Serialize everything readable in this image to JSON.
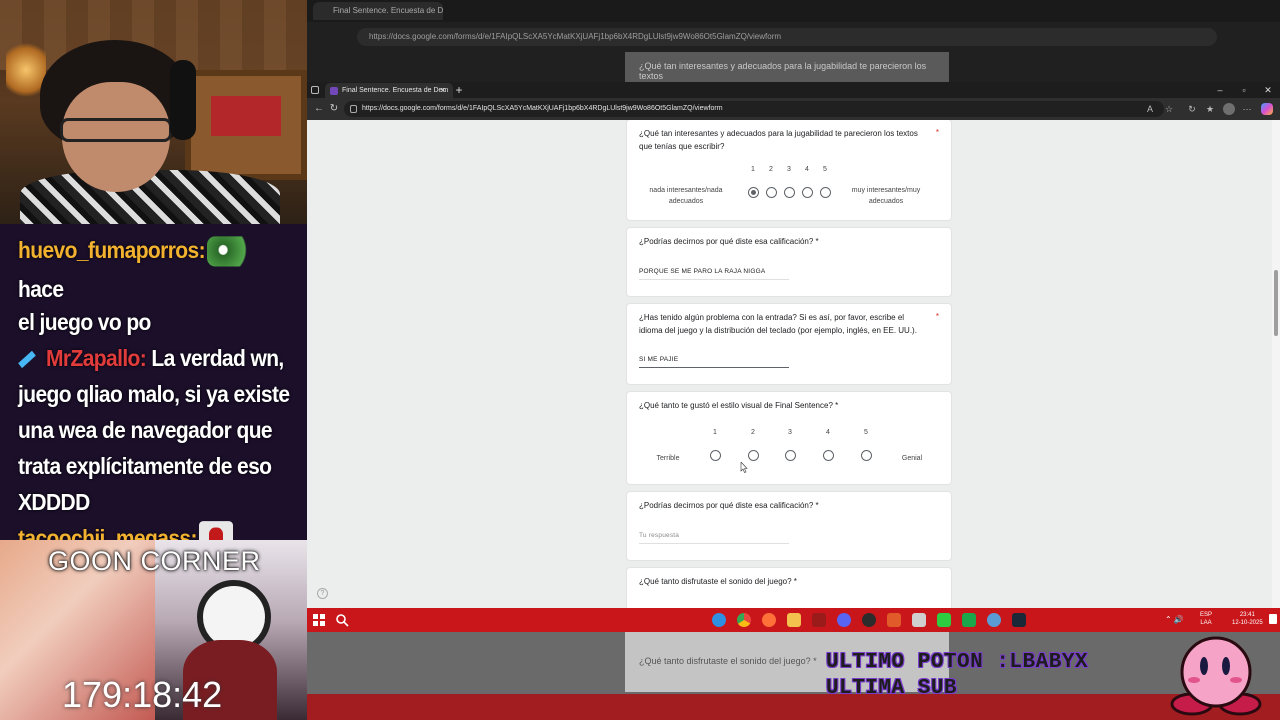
{
  "stream": {
    "chat": [
      {
        "user": "huevo_fumaporros:",
        "message_a": "hace",
        "message_b": "el juego vo po"
      },
      {
        "user": "MrZapallo:",
        "message_a": "La verdad wn,",
        "message_b": "juego qliao malo, si ya existe",
        "message_c": "una wea de navegador que",
        "message_d": "trata explícitamente de eso",
        "message_e": "XDDDD"
      },
      {
        "user": "tacoochii_megass:",
        "emote": "amogus-emote"
      }
    ],
    "panel_title": "GOON CORNER",
    "timer": "179:18:42",
    "banner": "ULTIMO POTON :LBABYX\nULTIMA SUB"
  },
  "bg_browser": {
    "tab_title": "Final Sentence. Encuesta de Dem...",
    "url": "https://docs.google.com/forms/d/e/1FAIpQLScXA5YcMatKXjUAFj1bp6bX4RDgLUlst9jw9Wo86Ot5GlamZQ/viewform",
    "peek_text": "¿Qué tan interesantes y adecuados para la jugabilidad te parecieron los textos"
  },
  "browser": {
    "tab_title": "Final Sentence. Encuesta de Dem",
    "url": "https://docs.google.com/forms/d/e/1FAIpQLScXA5YcMatKXjUAFj1bp6bX4RDgLUlst9jw9Wo86Ot5GlamZQ/viewform"
  },
  "form": {
    "q1": {
      "text": "¿Qué tan interesantes y adecuados para la jugabilidad te parecieron los textos que tenías que escribir?",
      "required": "*",
      "scale": [
        "1",
        "2",
        "3",
        "4",
        "5"
      ],
      "low_label": "nada interesantes/nada adecuados",
      "high_label": "muy interesantes/muy adecuados",
      "selected": 1
    },
    "q2": {
      "text": "¿Podrías decirnos por qué diste esa calificación? *",
      "answer": "PORQUE SE ME PARO LA RAJA NIGGA"
    },
    "q3": {
      "text": "¿Has tenido algún problema con la entrada? Si es así, por favor, escribe el idioma del juego y la distribución del teclado (por ejemplo, inglés, en EE. UU.).",
      "required": "*",
      "answer": "SI ME PAJIE"
    },
    "q4": {
      "text": "¿Qué tanto te gustó el estilo visual de Final Sentence? *",
      "scale": [
        "1",
        "2",
        "3",
        "4",
        "5"
      ],
      "low_label": "Terrible",
      "high_label": "Genial",
      "selected": null
    },
    "q5": {
      "text": "¿Podrías decirnos por qué diste esa calificación? *",
      "placeholder": "Tu respuesta"
    },
    "q6": {
      "text": "¿Qué tanto disfrutaste el sonido del juego? *"
    }
  },
  "taskbar": {
    "lang_top": "ESP",
    "lang_bottom": "LAA",
    "time": "23:41",
    "date": "12-10-2025"
  },
  "bg_bottom": {
    "ghost_text": "¿Qué tanto disfrutaste el sonido del juego? *"
  },
  "colors": {
    "accent_taskbar": "#c8161a",
    "chat_username": "#f2b230",
    "chat_bg": "#1b0f2a",
    "form_bg": "#eceded"
  }
}
